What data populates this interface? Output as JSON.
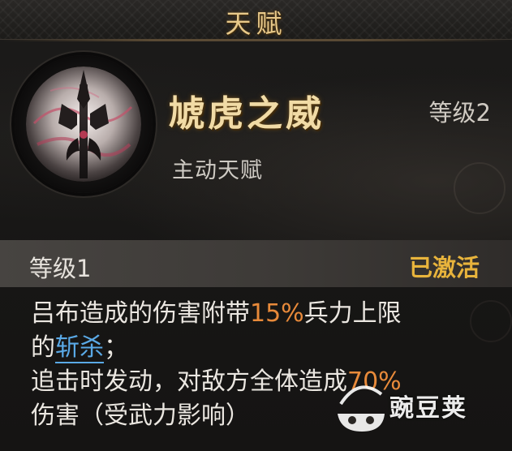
{
  "header": {
    "title": "天赋"
  },
  "talent": {
    "icon": "trident-halberd-icon",
    "name": "虓虎之威",
    "level": "等级2",
    "type": "主动天赋"
  },
  "level_section": {
    "label": "等级1",
    "status": "已激活"
  },
  "description": {
    "line1_a": "吕布造成的伤害附带",
    "line1_pct": "15%",
    "line1_b": "兵力上限",
    "line2_a": "的",
    "line2_link": "斩杀",
    "line2_b": "；",
    "line3_a": "追击时发动，对敌方全体造成",
    "line3_pct": "70%",
    "line4": "伤害（受武力影响）"
  },
  "watermark": {
    "text": "豌豆荚"
  },
  "colors": {
    "title_gold": "#e8c98a",
    "name_gold": "#f1dba6",
    "status_active": "#e8b43c",
    "percent_orange": "#e88a3a",
    "link_blue": "#5aa9e6"
  }
}
